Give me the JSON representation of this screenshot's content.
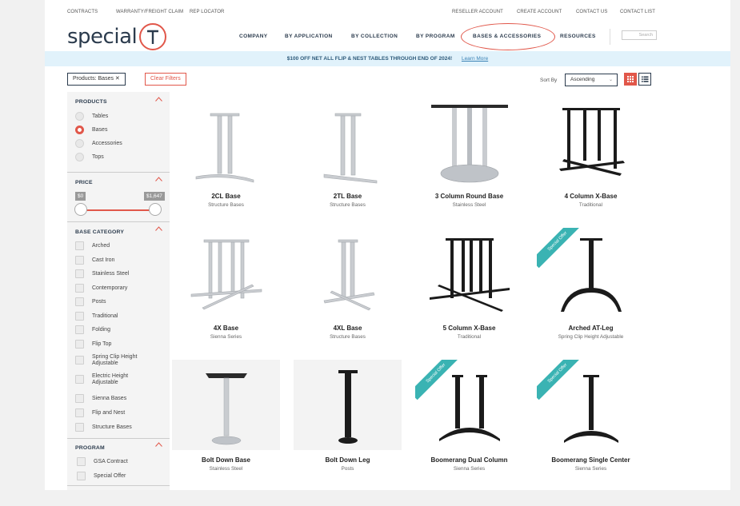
{
  "utility_nav": {
    "left": [
      "CONTRACTS",
      "WARRANTY/FREIGHT CLAIM",
      "REP LOCATOR"
    ],
    "right": [
      "RESELLER ACCOUNT",
      "CREATE ACCOUNT",
      "CONTACT US",
      "CONTACT LIST"
    ]
  },
  "brand": {
    "word": "special",
    "mark": "T",
    "accent": "#e1574a",
    "navy": "#2b3b4d"
  },
  "main_nav": [
    "COMPANY",
    "BY APPLICATION",
    "BY COLLECTION",
    "BY PROGRAM",
    "BASES & ACCESSORIES",
    "RESOURCES"
  ],
  "search": {
    "placeholder": "Search"
  },
  "promo": {
    "text": "$100 OFF NET ALL FLIP & NEST TABLES THROUGH END OF 2024!",
    "link": "Learn More"
  },
  "filters": {
    "active_chip": "Products: Bases ✕",
    "clear": "Clear Filters"
  },
  "sort": {
    "label": "Sort By",
    "value": "Ascending"
  },
  "sidebar": {
    "products": {
      "title": "PRODUCTS",
      "options": [
        "Tables",
        "Bases",
        "Accessories",
        "Tops"
      ],
      "selected": "Bases"
    },
    "price": {
      "title": "PRICE",
      "min": "$0",
      "max": "$1,647"
    },
    "base_category": {
      "title": "BASE CATEGORY",
      "options": [
        "Arched",
        "Cast Iron",
        "Stainless Steel",
        "Contemporary",
        "Posts",
        "Traditional",
        "Folding",
        "Flip Top",
        "Spring Clip Height Adjustable",
        "Electric Height Adjustable",
        "Sienna Bases",
        "Flip and Nest",
        "Structure Bases"
      ]
    },
    "program": {
      "title": "PROGRAM",
      "options": [
        "GSA Contract",
        "Special Offer"
      ]
    }
  },
  "products": [
    {
      "name": "2CL Base",
      "series": "Structure Bases",
      "special": false
    },
    {
      "name": "2TL Base",
      "series": "Structure Bases",
      "special": false
    },
    {
      "name": "3 Column Round Base",
      "series": "Stainless Steel",
      "special": false
    },
    {
      "name": "4 Column X-Base",
      "series": "Traditional",
      "special": false
    },
    {
      "name": "4X Base",
      "series": "Sienna Series",
      "special": false
    },
    {
      "name": "4XL Base",
      "series": "Structure Bases",
      "special": false
    },
    {
      "name": "5 Column X-Base",
      "series": "Traditional",
      "special": false
    },
    {
      "name": "Arched AT-Leg",
      "series": "Spring Clip Height Adjustable",
      "special": true
    },
    {
      "name": "Bolt Down Base",
      "series": "Stainless Steel",
      "special": false
    },
    {
      "name": "Bolt Down Leg",
      "series": "Posts",
      "special": false
    },
    {
      "name": "Boomerang Dual Column",
      "series": "Sienna Series",
      "special": true
    },
    {
      "name": "Boomerang Single Center",
      "series": "Sienna Series",
      "special": true
    }
  ],
  "ribbon_text": "Special Offer"
}
